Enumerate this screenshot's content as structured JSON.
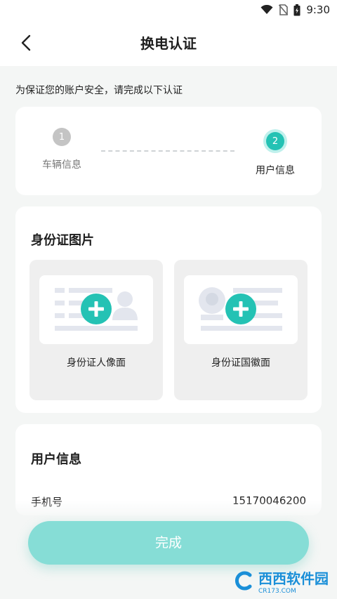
{
  "status_bar": {
    "time": "9:30"
  },
  "header": {
    "title": "换电认证"
  },
  "notice": "为保证您的账户安全，请完成以下认证",
  "steps": [
    {
      "number": "1",
      "label": "车辆信息",
      "state": "inactive"
    },
    {
      "number": "2",
      "label": "用户信息",
      "state": "active"
    }
  ],
  "id_card_section": {
    "title": "身份证图片",
    "uploads": [
      {
        "label": "身份证人像面"
      },
      {
        "label": "身份证国徽面"
      }
    ]
  },
  "user_info_section": {
    "title": "用户信息",
    "rows": [
      {
        "label": "手机号",
        "value": "15170046200"
      }
    ]
  },
  "actions": {
    "complete_label": "完成"
  },
  "watermark": {
    "brand": "西西软件园",
    "sub": "CR173.COM"
  },
  "colors": {
    "accent": "#24c2b4",
    "accent_light": "#bff0ec",
    "button": "#86ddd6",
    "background": "#f4f6f5"
  }
}
